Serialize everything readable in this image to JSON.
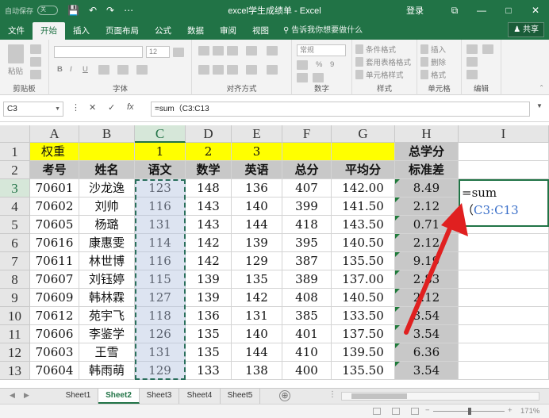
{
  "titlebar": {
    "autosave": "自动保存",
    "autosave_state": "关",
    "save": "💾",
    "undo": "↶",
    "redo": "↷",
    "customize": "⋯",
    "title": "excel学生成绩单 - Excel",
    "login": "登录",
    "ribbon_display": "⧉",
    "minimize": "—",
    "restore": "□",
    "close": "✕"
  },
  "tabs": [
    "文件",
    "开始",
    "插入",
    "页面布局",
    "公式",
    "数据",
    "审阅",
    "视图"
  ],
  "active_tab": "开始",
  "tell_me": "告诉我你想要做什么",
  "share": "共享",
  "ribbon": {
    "groups": [
      "剪贴板",
      "字体",
      "对齐方式",
      "数字",
      "样式",
      "单元格",
      "编辑"
    ],
    "paste": "粘贴",
    "font_size": "12",
    "bold": "B",
    "italic": "I",
    "underline": "U",
    "number_format": "常规",
    "percent": "%",
    "comma": "9",
    "conditional": "条件格式",
    "table_format": "套用表格格式",
    "cell_styles": "单元格样式",
    "insert": "插入",
    "delete": "删除",
    "format": "格式"
  },
  "formula_bar": {
    "name_box": "C3",
    "cancel": "✕",
    "enter": "✓",
    "fx": "fx",
    "formula": "=sum（C3:C13"
  },
  "columns": [
    "A",
    "B",
    "C",
    "D",
    "E",
    "F",
    "G",
    "H",
    "I"
  ],
  "selected_column": "C",
  "rows": [
    {
      "num": "1",
      "cells": [
        "权重",
        "",
        "1",
        "2",
        "3",
        "",
        "",
        "总学分",
        ""
      ]
    },
    {
      "num": "2",
      "cells": [
        "考号",
        "姓名",
        "语文",
        "数学",
        "英语",
        "总分",
        "平均分",
        "标准差",
        ""
      ]
    },
    {
      "num": "3",
      "cells": [
        "70601",
        "沙龙逸",
        "123",
        "148",
        "136",
        "407",
        "142.00",
        "8.49",
        ""
      ]
    },
    {
      "num": "4",
      "cells": [
        "70602",
        "刘帅",
        "116",
        "143",
        "140",
        "399",
        "141.50",
        "2.12",
        ""
      ]
    },
    {
      "num": "5",
      "cells": [
        "70605",
        "杨璐",
        "131",
        "143",
        "144",
        "418",
        "143.50",
        "0.71",
        ""
      ]
    },
    {
      "num": "6",
      "cells": [
        "70616",
        "康惠雯",
        "114",
        "142",
        "139",
        "395",
        "140.50",
        "2.12",
        ""
      ]
    },
    {
      "num": "7",
      "cells": [
        "70611",
        "林世博",
        "116",
        "142",
        "129",
        "387",
        "135.50",
        "9.19",
        ""
      ]
    },
    {
      "num": "8",
      "cells": [
        "70607",
        "刘钰婷",
        "115",
        "139",
        "135",
        "389",
        "137.00",
        "2.83",
        ""
      ]
    },
    {
      "num": "9",
      "cells": [
        "70609",
        "韩林霖",
        "127",
        "139",
        "142",
        "408",
        "140.50",
        "2.12",
        ""
      ]
    },
    {
      "num": "10",
      "cells": [
        "70612",
        "苑宇飞",
        "118",
        "136",
        "131",
        "385",
        "133.50",
        "3.54",
        ""
      ]
    },
    {
      "num": "11",
      "cells": [
        "70606",
        "李鉴学",
        "126",
        "135",
        "140",
        "401",
        "137.50",
        "3.54",
        ""
      ]
    },
    {
      "num": "12",
      "cells": [
        "70603",
        "王雪",
        "131",
        "135",
        "144",
        "410",
        "139.50",
        "6.36",
        ""
      ]
    },
    {
      "num": "13",
      "cells": [
        "70604",
        "韩雨萌",
        "129",
        "133",
        "138",
        "400",
        "135.50",
        "3.54",
        ""
      ]
    }
  ],
  "editing_cell": {
    "prefix": "=sum（",
    "ref": "C3:C13"
  },
  "sheets": [
    "Sheet1",
    "Sheet2",
    "Sheet3",
    "Sheet4",
    "Sheet5"
  ],
  "active_sheet": "Sheet2",
  "add_sheet": "⊕",
  "sheet_nav_prev": "◀",
  "sheet_nav_next": "▶",
  "status": {
    "zoom_out": "−",
    "zoom_in": "+",
    "zoom": "171%"
  },
  "colors": {
    "brand": "#217346",
    "highlight_row": "#ffff00",
    "header_gray": "#c8c8c8",
    "formula_ref": "#3a6fc9",
    "arrow": "#e02020"
  }
}
